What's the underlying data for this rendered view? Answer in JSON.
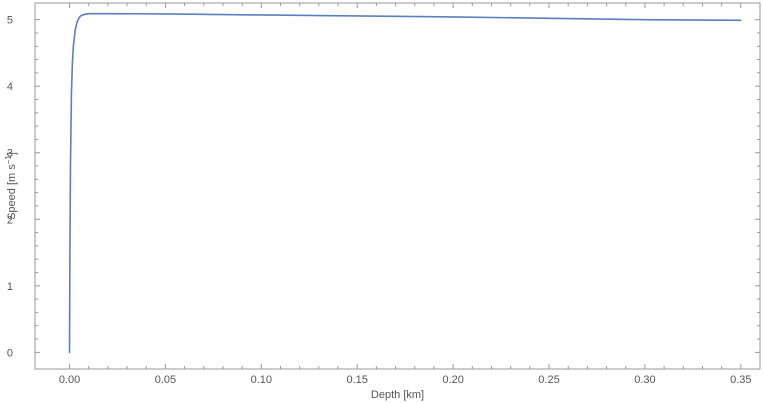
{
  "chart_data": {
    "type": "line",
    "title": "",
    "xlabel": "Depth [km]",
    "ylabel": "Speed [m s⁻¹]",
    "ylabel_parts": {
      "prefix": "Speed [m s",
      "superscript": "−1",
      "suffix": "]"
    },
    "xlim": [
      -0.018,
      0.36
    ],
    "ylim": [
      -0.25,
      5.25
    ],
    "x_ticks": [
      0.0,
      0.05,
      0.1,
      0.15,
      0.2,
      0.25,
      0.3,
      0.35
    ],
    "x_tick_labels": [
      "0.00",
      "0.05",
      "0.10",
      "0.15",
      "0.20",
      "0.25",
      "0.30",
      "0.35"
    ],
    "y_ticks": [
      0,
      1,
      2,
      3,
      4,
      5
    ],
    "y_tick_labels": [
      "0",
      "1",
      "2",
      "3",
      "4",
      "5"
    ],
    "grid": false,
    "frame": true,
    "colors": {
      "series": "#5b7fbf",
      "frame": "#999999",
      "tick_text": "#555555"
    },
    "series": [
      {
        "x": [
          0.0,
          0.0002,
          0.0005,
          0.001,
          0.0015,
          0.002,
          0.003,
          0.004,
          0.005,
          0.006,
          0.008,
          0.01,
          0.02,
          0.05,
          0.1,
          0.15,
          0.2,
          0.25,
          0.3,
          0.35
        ],
        "y": [
          0.0,
          1.5,
          2.8,
          3.9,
          4.35,
          4.6,
          4.85,
          4.97,
          5.03,
          5.06,
          5.08,
          5.09,
          5.09,
          5.085,
          5.07,
          5.055,
          5.04,
          5.02,
          5.0,
          4.99
        ]
      }
    ]
  }
}
